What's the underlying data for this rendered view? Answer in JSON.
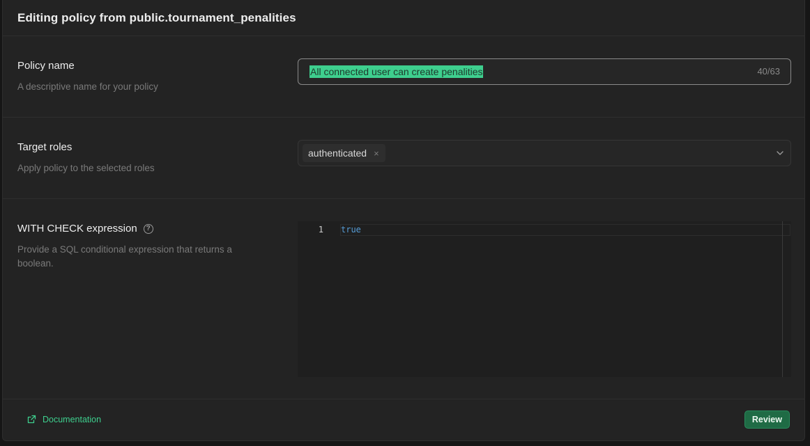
{
  "modal": {
    "title": "Editing policy from public.tournament_penalities"
  },
  "policy_name": {
    "label": "Policy name",
    "description": "A descriptive name for your policy",
    "value": "All connected user can create penalities",
    "char_count": "40/63"
  },
  "target_roles": {
    "label": "Target roles",
    "description": "Apply policy to the selected roles",
    "selected": [
      "authenticated"
    ],
    "chip_remove": "×"
  },
  "with_check": {
    "label": "WITH CHECK expression",
    "help": "?",
    "description": "Provide a SQL conditional expression that returns a boolean.",
    "line_number": "1",
    "code": "true"
  },
  "footer": {
    "documentation_label": "Documentation",
    "review_label": "Review"
  },
  "colors": {
    "accent": "#3ecf8e",
    "button_bg": "#1f6b45",
    "panel_bg": "#232323"
  },
  "icons": {
    "external_link": "external-link-icon",
    "chevron": "chevron-down-icon",
    "help": "help-circle-icon",
    "close": "close-icon"
  }
}
